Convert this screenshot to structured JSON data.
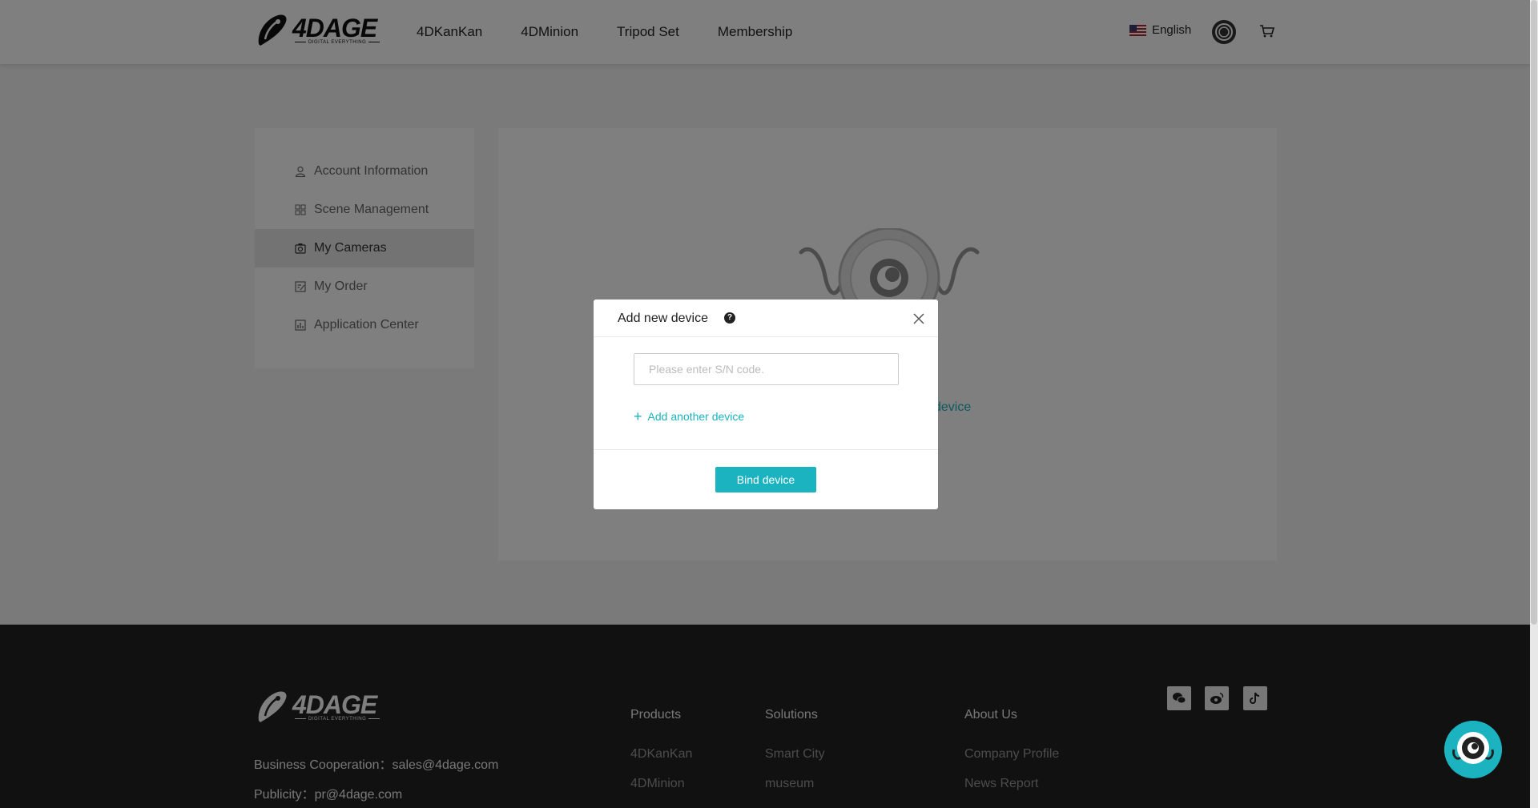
{
  "header": {
    "logo_text": "4DAGE",
    "logo_sub": "DIGITAL EVERYTHING",
    "nav": [
      "4DKanKan",
      "4DMinion",
      "Tripod Set",
      "Membership"
    ],
    "language": "English"
  },
  "sidebar": {
    "items": [
      {
        "label": "Account Information",
        "icon": "user-icon"
      },
      {
        "label": "Scene Management",
        "icon": "grid-icon"
      },
      {
        "label": "My Cameras",
        "icon": "camera-icon",
        "active": true
      },
      {
        "label": "My Order",
        "icon": "order-icon"
      },
      {
        "label": "Application Center",
        "icon": "chart-icon"
      }
    ]
  },
  "content": {
    "link_fragment": "device"
  },
  "modal": {
    "title": "Add new device",
    "help": "?",
    "input_placeholder": "Please enter S/N code.",
    "input_value": "",
    "add_another": "Add another device",
    "bind_button": "Bind device"
  },
  "footer": {
    "logo_text": "4DAGE",
    "logo_sub": "DIGITAL EVERYTHING",
    "business": "Business Cooperation：sales@4dage.com",
    "publicity": "Publicity：pr@4dage.com",
    "columns": [
      {
        "title": "Products",
        "items": [
          "4DKanKan",
          "4DMinion"
        ]
      },
      {
        "title": "Solutions",
        "items": [
          "Smart City",
          "museum"
        ]
      },
      {
        "title": "About Us",
        "items": [
          "Company Profile",
          "News Report"
        ]
      }
    ],
    "social": [
      "wechat-icon",
      "weibo-icon",
      "tiktok-icon"
    ]
  },
  "colors": {
    "accent": "#1bb3bf",
    "footer_bg": "#222222",
    "overlay": "rgba(0,0,0,0.5)"
  }
}
